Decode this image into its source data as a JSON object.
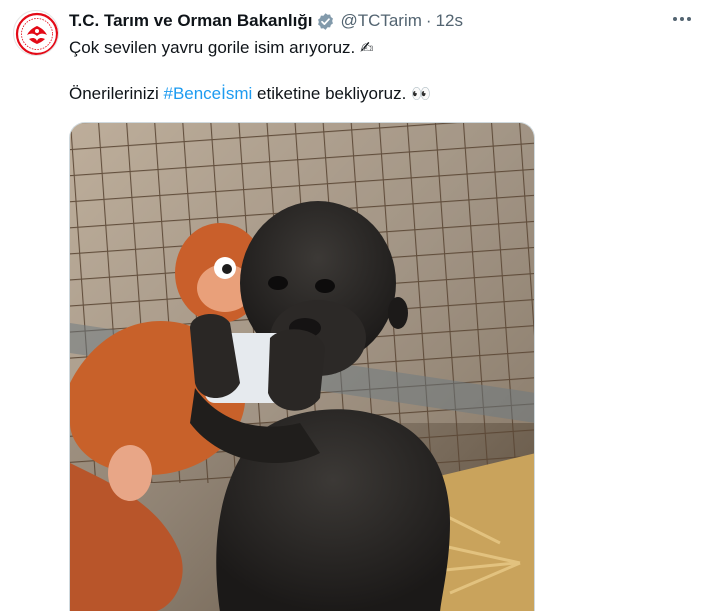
{
  "tweet": {
    "author_name": "T.C. Tarım ve Orman Bakanlığı",
    "handle": "@TCTarim",
    "separator": "·",
    "time": "12s",
    "line1": "Çok sevilen yavru gorile isim arıyoruz.",
    "line1_emoji": "✍",
    "line2_pre": "Önerilerinizi",
    "hashtag": "#Benceİsmi",
    "line2_post": "etiketine bekliyoruz.",
    "line2_emoji": "👀"
  },
  "media": {
    "alt": "Baby gorilla holding a white cup in front of an orange plush toy behind a wire fence"
  },
  "colors": {
    "accent": "#1d9bf0",
    "text": "#0f1419",
    "secondary": "#536471",
    "verified_badge": "#829aab"
  },
  "icons": [
    "ministry-logo-icon",
    "verified-badge-icon",
    "more-options-icon"
  ]
}
